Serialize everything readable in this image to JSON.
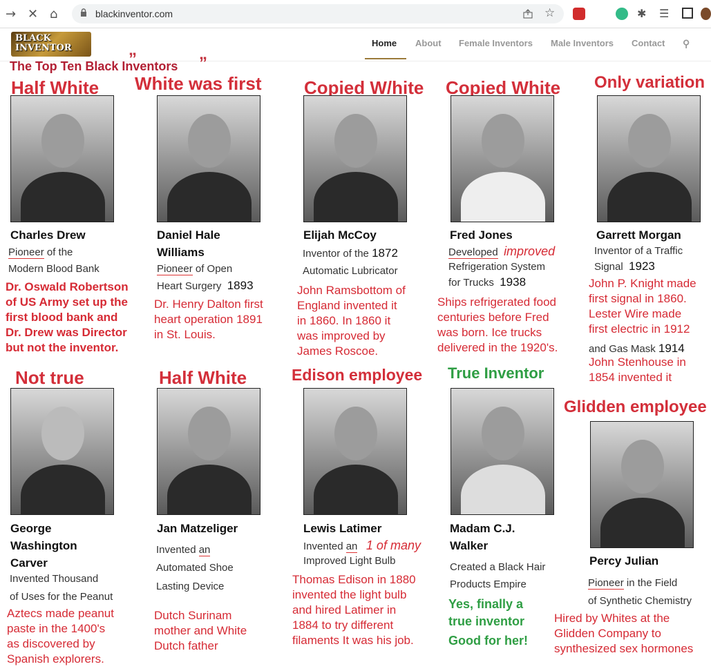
{
  "browser": {
    "url": "blackinventor.com"
  },
  "logo": {
    "text": "BLACK INVENTOR"
  },
  "menu": {
    "home": "Home",
    "about": "About",
    "female": "Female Inventors",
    "male": "Male Inventors",
    "contact": "Contact"
  },
  "page_title": "The Top Ten Black Inventors",
  "quote_open": "”",
  "quote_close": "”",
  "cards": [
    {
      "tag": "Half White",
      "name1": "Charles Drew",
      "name2": "",
      "desc1": "Pioneer",
      "desc1b": " of the",
      "desc2": "Modern Blood Bank",
      "desc3": "",
      "comment": [
        "Dr. Oswald Robertson",
        "of US Army set up the",
        "first blood bank and",
        "Dr. Drew was Director",
        "but not the inventor."
      ]
    },
    {
      "tag": "White was first",
      "name1": "Daniel Hale",
      "name2": "Williams",
      "desc1": "Pioneer",
      "desc1b": " of Open",
      "desc2": "Heart Surgery",
      "year": "1893",
      "comment": [
        "Dr. Henry Dalton first",
        "heart operation 1891",
        "in St. Louis."
      ]
    },
    {
      "tag": "Copied W/hite",
      "name1": "Elijah McCoy",
      "desc1": "Inventor of the",
      "year": "1872",
      "desc2": "Automatic Lubricator",
      "comment": [
        "John Ramsbottom of",
        "England invented it",
        "in 1860.  In 1860 it",
        "was improved by",
        "James Roscoe."
      ]
    },
    {
      "tag": "Copied White",
      "name1": "Fred Jones",
      "desc1": "Developed",
      "aside": "improved",
      "desc2": "Refrigeration System",
      "desc3": "for Trucks",
      "year": "1938",
      "comment": [
        "Ships refrigerated food",
        "centuries before Fred",
        "was born. Ice trucks",
        "delivered in the 1920's."
      ]
    },
    {
      "tag": "Only variation",
      "name1": "Garrett Morgan",
      "desc1": "Inventor of a Traffic",
      "desc2": "Signal",
      "year": "1923",
      "comment": [
        "John P. Knight made",
        "first signal in 1860.",
        "Lester Wire made",
        "first electric in 1912"
      ],
      "desc3": "and Gas Mask",
      "year2": "1914",
      "comment2": [
        "John Stenhouse in",
        "1854 invented it"
      ]
    },
    {
      "tag": "Not true",
      "name1": "George",
      "name2": "Washington",
      "name3": "Carver",
      "desc1": "Invented Thousand",
      "desc2": "of Uses for the Peanut",
      "comment": [
        "Aztecs made peanut",
        "paste in the 1400's",
        "as discovered by",
        "Spanish explorers."
      ]
    },
    {
      "tag": "Half White",
      "name1": "Jan Matzeliger",
      "desc1": "Invented",
      "desc1u": "an",
      "desc2": "Automated Shoe",
      "desc3": "Lasting Device",
      "comment": [
        "Dutch Surinam",
        "mother and White",
        "Dutch father"
      ]
    },
    {
      "tag": "Edison employee",
      "name1": "Lewis Latimer",
      "desc1": "Invented",
      "desc1u": "an",
      "aside": "1 of many",
      "desc2": "Improved Light Bulb",
      "comment": [
        "Thomas Edison in 1880",
        "invented the light bulb",
        "and hired Latimer in",
        "1884 to try different",
        "filaments  It was his job."
      ]
    },
    {
      "tag": "True Inventor",
      "name1": "Madam C.J.",
      "name2": "Walker",
      "desc1": "Created a Black Hair",
      "desc2": "Products Empire",
      "comment": [
        "Yes, finally a",
        "true inventor",
        "Good for her!"
      ]
    },
    {
      "tag": "Glidden employee",
      "name1": "Percy Julian",
      "desc1": "Pioneer",
      "desc1b": " in the Field",
      "desc2": "of Synthetic  Chemistry",
      "comment": [
        "Hired by Whites at the",
        "Glidden Company to",
        "synthesized sex hormones"
      ]
    }
  ]
}
